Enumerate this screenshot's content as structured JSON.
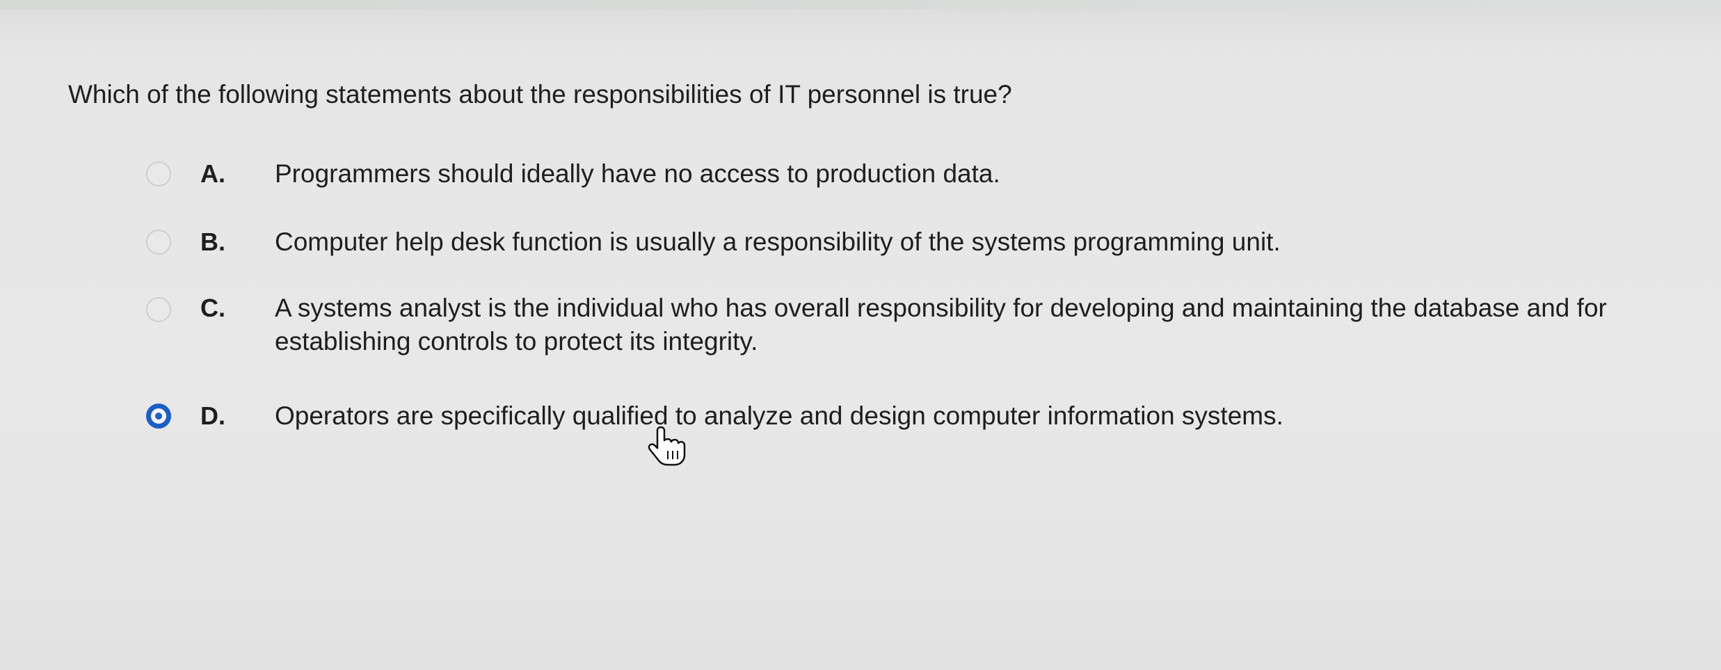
{
  "question": {
    "text": "Which of the following statements about the responsibilities of IT personnel is true?"
  },
  "choices": [
    {
      "letter": "A.",
      "text": "Programmers should ideally have no access to production data.",
      "selected": false
    },
    {
      "letter": "B.",
      "text": "Computer help desk function is usually a responsibility of the systems programming unit.",
      "selected": false
    },
    {
      "letter": "C.",
      "text": "A systems analyst is the individual who has overall responsibility for developing and maintaining the database and for establishing controls to protect its integrity.",
      "selected": false
    },
    {
      "letter": "D.",
      "text": "Operators are specifically qualified to analyze and design computer information systems.",
      "selected": true
    }
  ],
  "colors": {
    "accent": "#1a5fc8",
    "background": "#e6e6e6",
    "text": "#1e1e1e"
  },
  "icons": {
    "cursor": "hand-pointer-icon"
  }
}
